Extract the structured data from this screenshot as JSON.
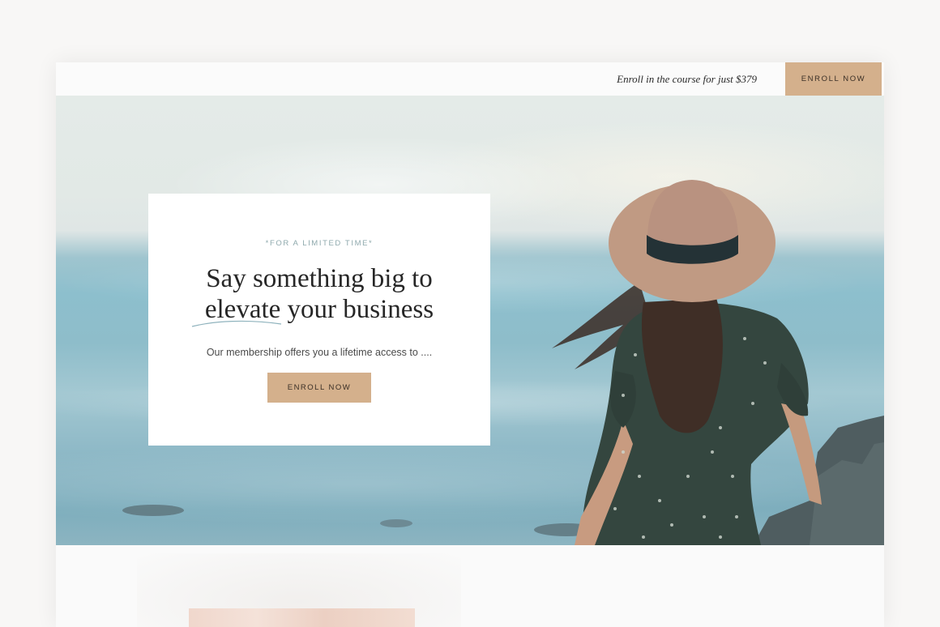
{
  "topbar": {
    "promo_text": "Enroll in the course for just $379",
    "cta_label": "ENROLL NOW"
  },
  "hero": {
    "eyebrow": "*FOR A LIMITED TIME*",
    "headline_line1": "Say something big to",
    "headline_line2": "elevate your business",
    "subtext": "Our membership offers you a lifetime access to ....",
    "cta_label": "ENROLL NOW"
  },
  "colors": {
    "accent": "#d4b08c",
    "eyebrow": "#8fa9ad",
    "text_dark": "#262626"
  }
}
